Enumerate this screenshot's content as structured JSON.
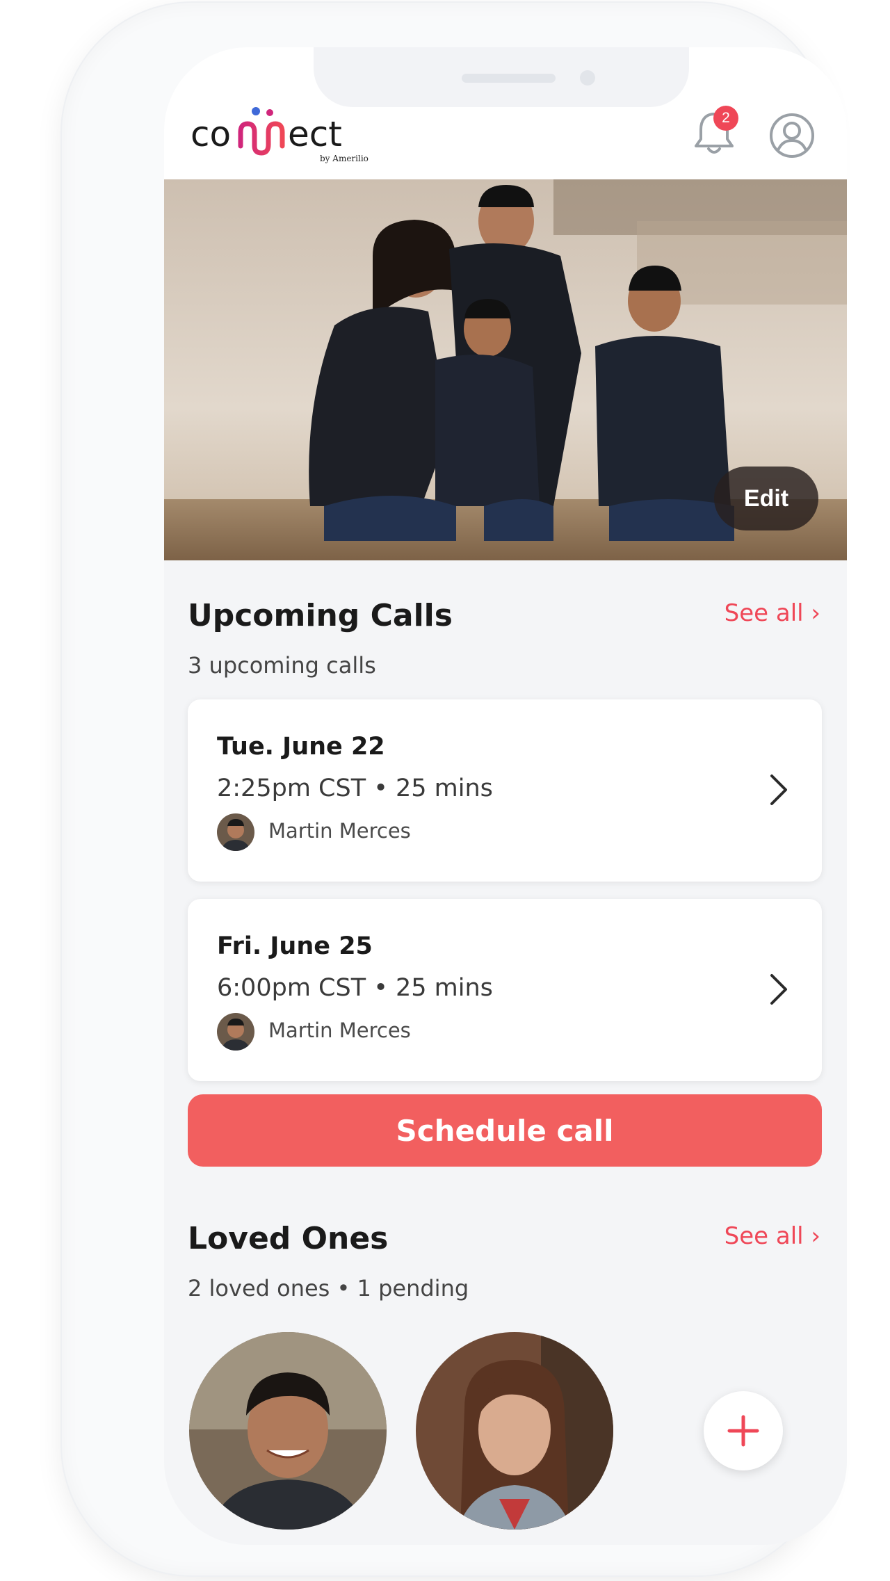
{
  "app": {
    "logo_text": "connect",
    "logo_tagline": "by Amerilio",
    "notifications_count": "2"
  },
  "hero": {
    "edit_label": "Edit"
  },
  "upcoming": {
    "title": "Upcoming Calls",
    "subtitle": "3 upcoming calls",
    "see_all": "See all ›",
    "calls": [
      {
        "date": "Tue. June 22",
        "time": "2:25pm CST • 25 mins",
        "person": "Martin Merces"
      },
      {
        "date": "Fri. June 25",
        "time": "6:00pm CST • 25 mins",
        "person": "Martin Merces"
      }
    ],
    "schedule_label": "Schedule call"
  },
  "loved_ones": {
    "title": "Loved Ones",
    "subtitle": "2 loved ones • 1 pending",
    "see_all": "See all ›"
  },
  "colors": {
    "accent": "#ef4757",
    "button": "#f25f5f",
    "background": "#f4f5f7"
  },
  "icons": [
    "bell-icon",
    "profile-icon",
    "chevron-right-icon",
    "plus-icon"
  ]
}
